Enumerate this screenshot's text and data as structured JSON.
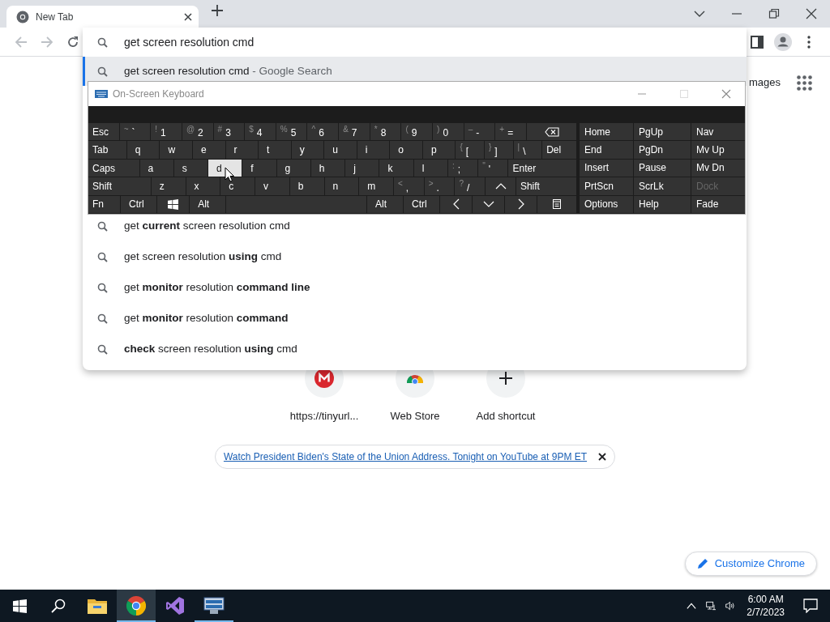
{
  "browser": {
    "tabs": [
      {
        "title": "New Tab",
        "selected": true
      }
    ]
  },
  "omnibox": {
    "value": "get screen resolution cmd",
    "suggestions": [
      {
        "text": "get screen resolution cmd",
        "suffix": "- Google Search",
        "selected": true
      },
      {
        "text": "get **current** screen resolution cmd",
        "selected": false
      },
      {
        "text": "get screen resolution **using** cmd",
        "selected": false
      },
      {
        "text": "get **monitor** resolution **command line**",
        "selected": false
      },
      {
        "text": "get **monitor** resolution **command**",
        "selected": false
      },
      {
        "text": "**check** screen resolution **using** cmd",
        "selected": false
      }
    ]
  },
  "page": {
    "header_link": "mages",
    "shortcuts": [
      {
        "kind": "site",
        "label": "https://tinyurl..."
      },
      {
        "kind": "store",
        "label": "Web Store"
      },
      {
        "kind": "add",
        "label": "Add shortcut"
      }
    ],
    "promo": "Watch President Biden's State of the Union Address. Tonight on YouTube at 9PM ET",
    "customize": "Customize Chrome"
  },
  "keyboard": {
    "title": "On-Screen Keyboard",
    "rows": [
      [
        {
          "kind": "text",
          "label": "Esc",
          "hover": false
        },
        {
          "kind": "char",
          "shift": "~",
          "main": "`",
          "hover": false
        },
        {
          "kind": "char",
          "shift": "!",
          "main": "1",
          "hover": false
        },
        {
          "kind": "char",
          "shift": "@",
          "main": "2",
          "hover": false
        },
        {
          "kind": "char",
          "shift": "#",
          "main": "3",
          "hover": false
        },
        {
          "kind": "char",
          "shift": "$",
          "main": "4",
          "hover": false
        },
        {
          "kind": "char",
          "shift": "%",
          "main": "5",
          "hover": false
        },
        {
          "kind": "char",
          "shift": "^",
          "main": "6",
          "hover": false
        },
        {
          "kind": "char",
          "shift": "&",
          "main": "7",
          "hover": false
        },
        {
          "kind": "char",
          "shift": "*",
          "main": "8",
          "hover": false
        },
        {
          "kind": "char",
          "shift": "(",
          "main": "9",
          "hover": false
        },
        {
          "kind": "char",
          "shift": ")",
          "main": "0",
          "hover": false
        },
        {
          "kind": "char",
          "shift": "–",
          "main": "-",
          "hover": false
        },
        {
          "kind": "char",
          "shift": "+",
          "main": "=",
          "hover": false
        },
        {
          "kind": "backspace",
          "hover": false
        }
      ],
      [
        {
          "kind": "text",
          "label": "Tab",
          "hover": false
        },
        {
          "kind": "text",
          "label": "q",
          "hover": false
        },
        {
          "kind": "text",
          "label": "w",
          "hover": false
        },
        {
          "kind": "text",
          "label": "e",
          "hover": false
        },
        {
          "kind": "text",
          "label": "r",
          "hover": false
        },
        {
          "kind": "text",
          "label": "t",
          "hover": false
        },
        {
          "kind": "text",
          "label": "y",
          "hover": false
        },
        {
          "kind": "text",
          "label": "u",
          "hover": false
        },
        {
          "kind": "text",
          "label": "i",
          "hover": false
        },
        {
          "kind": "text",
          "label": "o",
          "hover": false
        },
        {
          "kind": "text",
          "label": "p",
          "hover": false
        },
        {
          "kind": "char",
          "shift": "{",
          "main": "[",
          "hover": false
        },
        {
          "kind": "char",
          "shift": "}",
          "main": "]",
          "hover": false
        },
        {
          "kind": "char",
          "shift": "|",
          "main": "\\",
          "hover": false
        },
        {
          "kind": "text",
          "label": "Del",
          "hover": false
        }
      ],
      [
        {
          "kind": "text",
          "label": "Caps",
          "hover": false
        },
        {
          "kind": "text",
          "label": "a",
          "hover": false
        },
        {
          "kind": "text",
          "label": "s",
          "hover": false
        },
        {
          "kind": "text",
          "label": "d",
          "hover": true
        },
        {
          "kind": "text",
          "label": "f",
          "hover": false
        },
        {
          "kind": "text",
          "label": "g",
          "hover": false
        },
        {
          "kind": "text",
          "label": "h",
          "hover": false
        },
        {
          "kind": "text",
          "label": "j",
          "hover": false
        },
        {
          "kind": "text",
          "label": "k",
          "hover": false
        },
        {
          "kind": "text",
          "label": "l",
          "hover": false
        },
        {
          "kind": "char",
          "shift": ":",
          "main": ";",
          "hover": false
        },
        {
          "kind": "char",
          "shift": "\"",
          "main": "'",
          "hover": false
        },
        {
          "kind": "text",
          "label": "Enter",
          "hover": false
        }
      ],
      [
        {
          "kind": "text",
          "label": "Shift",
          "hover": false
        },
        {
          "kind": "text",
          "label": "z",
          "hover": false
        },
        {
          "kind": "text",
          "label": "x",
          "hover": false
        },
        {
          "kind": "text",
          "label": "c",
          "hover": false
        },
        {
          "kind": "text",
          "label": "v",
          "hover": false
        },
        {
          "kind": "text",
          "label": "b",
          "hover": false
        },
        {
          "kind": "text",
          "label": "n",
          "hover": false
        },
        {
          "kind": "text",
          "label": "m",
          "hover": false
        },
        {
          "kind": "char",
          "shift": "<",
          "main": ",",
          "hover": false
        },
        {
          "kind": "char",
          "shift": ">",
          "main": ".",
          "hover": false
        },
        {
          "kind": "char",
          "shift": "?",
          "main": "/",
          "hover": false
        },
        {
          "kind": "up",
          "hover": false
        },
        {
          "kind": "text",
          "label": "Shift",
          "hover": false
        }
      ],
      [
        {
          "kind": "text",
          "label": "Fn",
          "hover": false
        },
        {
          "kind": "text",
          "label": "Ctrl",
          "hover": false
        },
        {
          "kind": "windows",
          "hover": false
        },
        {
          "kind": "text",
          "label": "Alt",
          "hover": false
        },
        {
          "kind": "space",
          "hover": false
        },
        {
          "kind": "text",
          "label": "Alt",
          "hover": false
        },
        {
          "kind": "text",
          "label": "Ctrl",
          "hover": false
        },
        {
          "kind": "left",
          "hover": false
        },
        {
          "kind": "down",
          "hover": false
        },
        {
          "kind": "right",
          "hover": false
        },
        {
          "kind": "menu",
          "hover": false
        }
      ]
    ],
    "nav": [
      [
        {
          "label": "Home",
          "disabled": false
        },
        {
          "label": "PgUp",
          "disabled": false
        },
        {
          "label": "Nav",
          "disabled": false
        }
      ],
      [
        {
          "label": "End",
          "disabled": false
        },
        {
          "label": "PgDn",
          "disabled": false
        },
        {
          "label": "Mv Up",
          "disabled": false
        }
      ],
      [
        {
          "label": "Insert",
          "disabled": false
        },
        {
          "label": "Pause",
          "disabled": false
        },
        {
          "label": "Mv Dn",
          "disabled": false
        }
      ],
      [
        {
          "label": "PrtScn",
          "disabled": false
        },
        {
          "label": "ScrLk",
          "disabled": false
        },
        {
          "label": "Dock",
          "disabled": true
        }
      ],
      [
        {
          "label": "Options",
          "disabled": false
        },
        {
          "label": "Help",
          "disabled": false
        },
        {
          "label": "Fade",
          "disabled": false
        }
      ]
    ]
  },
  "taskbar": {
    "apps": [
      {
        "kind": "explorer",
        "selected": false,
        "running": false
      },
      {
        "kind": "chrome",
        "selected": true,
        "running": true
      },
      {
        "kind": "studio",
        "selected": false,
        "running": false
      },
      {
        "kind": "keyboard",
        "selected": false,
        "running": true
      }
    ],
    "time": "6:00 AM",
    "date": "2/7/2023"
  }
}
